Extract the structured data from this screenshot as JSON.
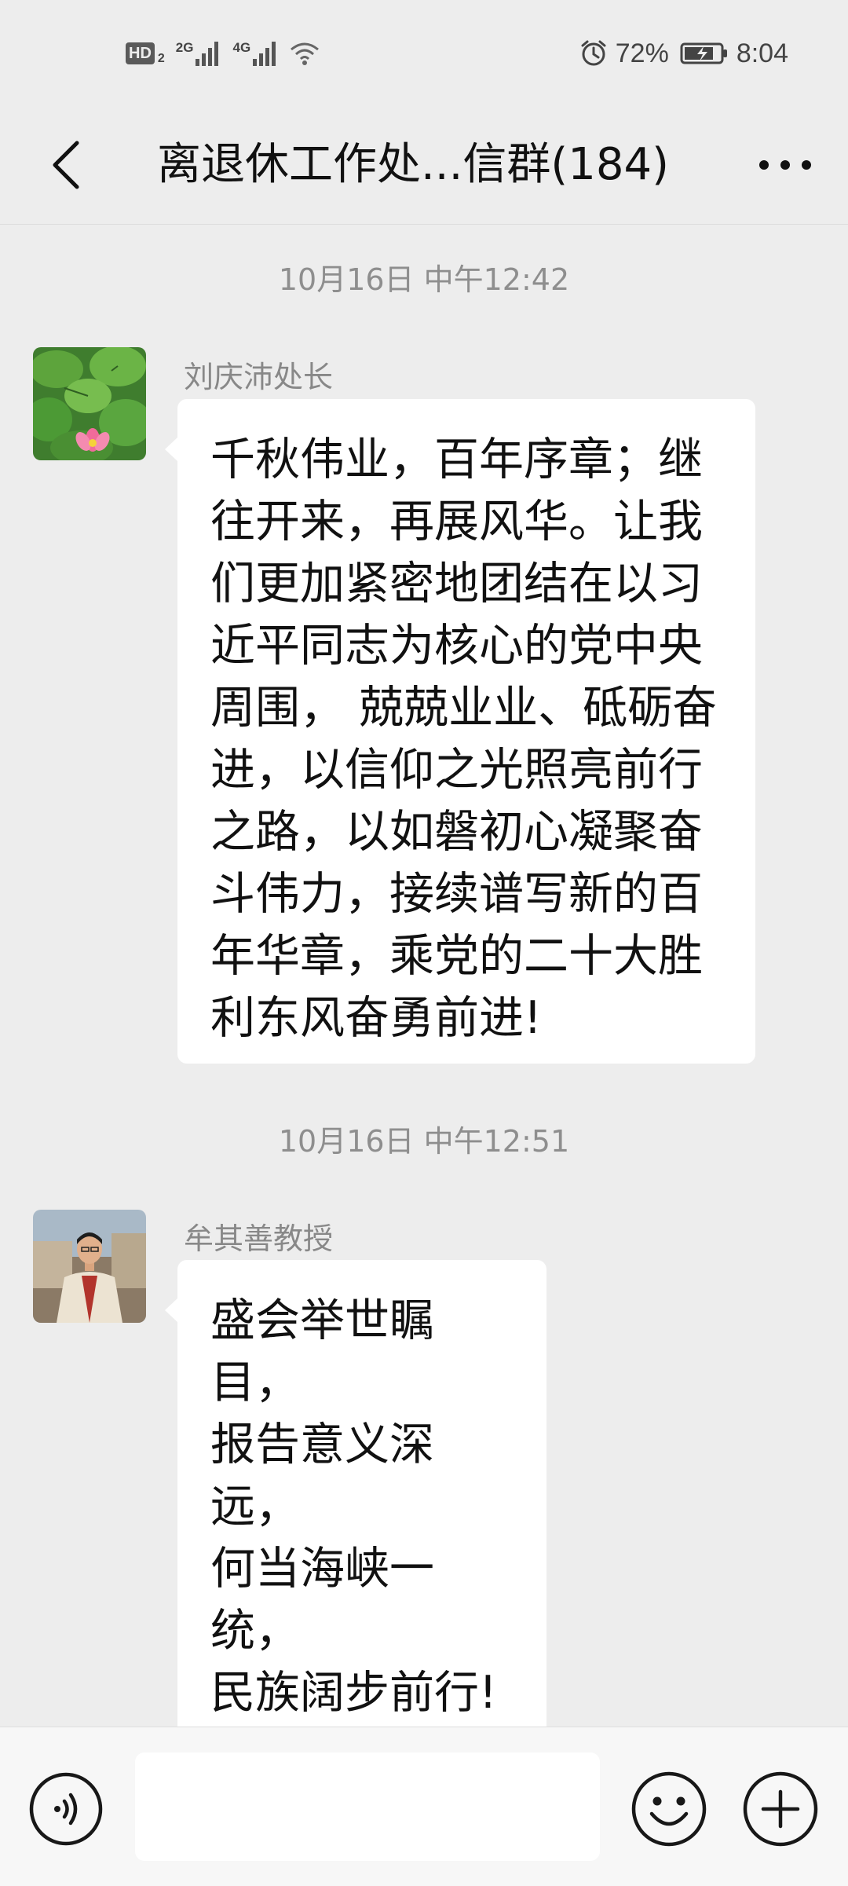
{
  "status_bar": {
    "hd_label": "HD",
    "sim_number": "2",
    "net1_label": "2G",
    "net2_label": "4G",
    "alarm_icon": "alarm-clock-icon",
    "battery_percent": "72%",
    "time": "8:04"
  },
  "header": {
    "title": "离退休工作处...信群(184)",
    "back_icon": "chevron-left-icon",
    "more_icon": "more-dots-icon"
  },
  "messages": [
    {
      "timestamp": "10月16日 中午12:42",
      "sender": "刘庆沛处长",
      "avatar_icon": "lotus-avatar",
      "text": "千秋伟业，百年序章；继往开来，再展风华。让我们更加紧密地团结在以习近平同志为核心的党中央周围， 兢兢业业、砥砺奋进，以信仰之光照亮前行之路，以如磐初心凝聚奋斗伟力，接续谱写新的百年华章，乘党的二十大胜利东风奋勇前进!"
    },
    {
      "timestamp": "10月16日 中午12:51",
      "sender": "牟其善教授",
      "avatar_icon": "person-avatar",
      "text": "盛会举世瞩目，\n报告意义深远，\n何当海峡一统，\n民族阔步前行!"
    }
  ],
  "input_bar": {
    "voice_icon": "voice-icon",
    "input_value": "",
    "emoji_icon": "emoji-icon",
    "plus_icon": "plus-icon"
  },
  "colors": {
    "background": "#ededed",
    "bubble": "#ffffff",
    "timestamp_text": "#8e8e8e",
    "sender_text": "#888888",
    "input_bar": "#f7f7f7"
  }
}
